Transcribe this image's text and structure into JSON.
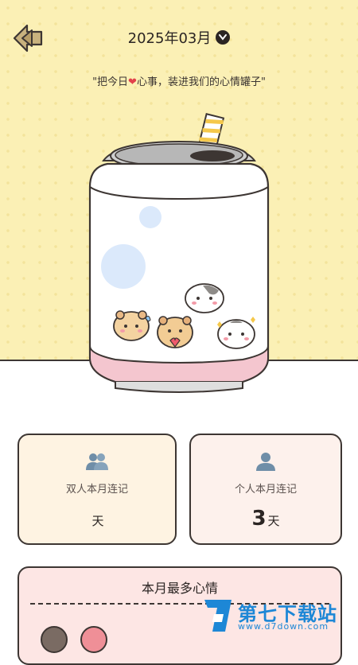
{
  "header": {
    "month": "2025年03月",
    "quote_prefix": "\"把今日",
    "quote_heart": "❤",
    "quote_suffix": "心事，装进我们的心情罐子\""
  },
  "stats": {
    "couple": {
      "label": "双人本月连记",
      "value": "",
      "unit": "天"
    },
    "personal": {
      "label": "个人本月连记",
      "value": "3",
      "unit": "天"
    }
  },
  "mood": {
    "title": "本月最多心情"
  },
  "watermark": {
    "brand": "第七下载站",
    "url": "www.d7down.com"
  },
  "colors": {
    "background": "#fbf0b5",
    "card_left": "#fef3e2",
    "card_right": "#fdf1ec",
    "mood_card": "#fde6e4",
    "outline": "#3d3633"
  },
  "icons": [
    "back-arrow-icon",
    "chevron-down-icon",
    "two-users-icon",
    "single-user-icon"
  ]
}
